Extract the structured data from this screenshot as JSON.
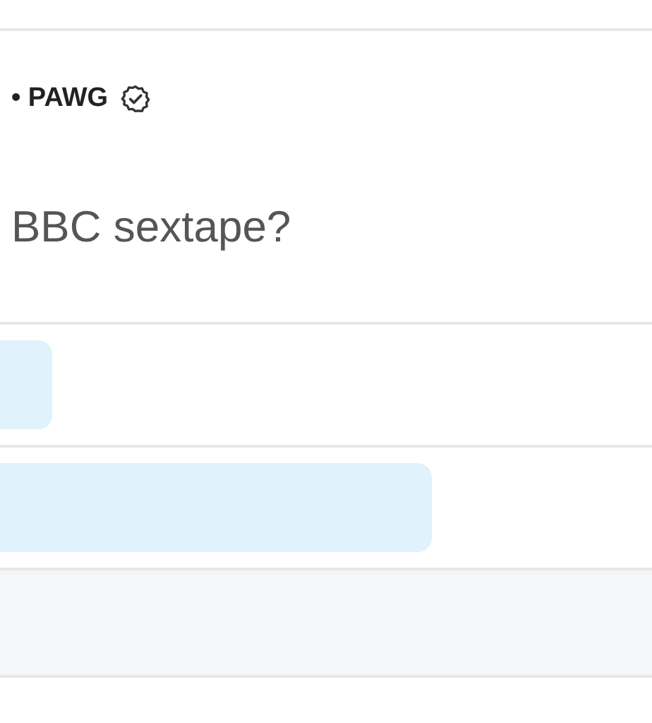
{
  "post": {
    "author": "• PAWG",
    "verified": true,
    "text": "BBC sextape?"
  },
  "poll": {
    "options": [
      {
        "level": 0.08
      },
      {
        "level": 0.663
      }
    ]
  }
}
